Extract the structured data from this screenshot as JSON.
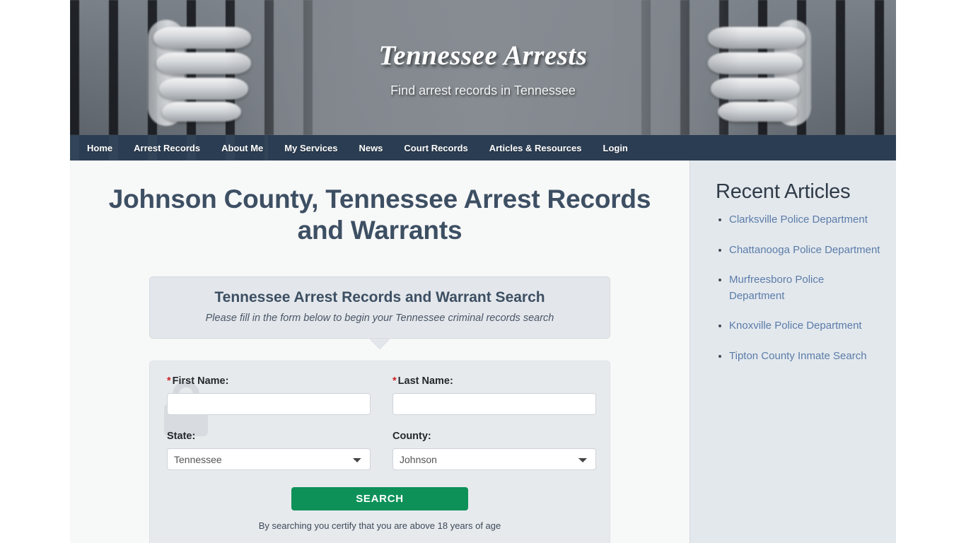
{
  "site": {
    "title": "Tennessee Arrests",
    "tagline": "Find arrest records in Tennessee"
  },
  "nav": {
    "items": [
      {
        "label": "Home"
      },
      {
        "label": "Arrest Records"
      },
      {
        "label": "About Me"
      },
      {
        "label": "My Services"
      },
      {
        "label": "News"
      },
      {
        "label": "Court Records"
      },
      {
        "label": "Articles & Resources"
      },
      {
        "label": "Login"
      }
    ]
  },
  "main": {
    "page_title": "Johnson County, Tennessee Arrest Records and Warrants",
    "callout": {
      "title": "Tennessee Arrest Records and Warrant Search",
      "subtitle": "Please fill in the form below to begin your Tennessee criminal records search"
    },
    "form": {
      "required_marker": "*",
      "first_name": {
        "label": "First Name:",
        "value": "",
        "placeholder": ""
      },
      "last_name": {
        "label": "Last Name:",
        "value": "",
        "placeholder": ""
      },
      "state": {
        "label": "State:",
        "selected": "Tennessee",
        "options": [
          "Tennessee"
        ]
      },
      "county": {
        "label": "County:",
        "selected": "Johnson",
        "options": [
          "Johnson"
        ]
      },
      "submit_label": "SEARCH",
      "disclaimer": "By searching you certify that you are above 18 years of age"
    }
  },
  "sidebar": {
    "title": "Recent Articles",
    "articles": [
      {
        "label": "Clarksville Police Department"
      },
      {
        "label": "Chattanooga Police Department"
      },
      {
        "label": "Murfreesboro Police Department"
      },
      {
        "label": "Knoxville Police Department"
      },
      {
        "label": "Tipton County Inmate Search"
      }
    ]
  },
  "colors": {
    "nav_bg": "#2b3d52",
    "heading": "#3d4f63",
    "link": "#5b7ca8",
    "button": "#0d9159",
    "required": "#cc2222",
    "sidebar_bg": "#e3e8ed"
  }
}
